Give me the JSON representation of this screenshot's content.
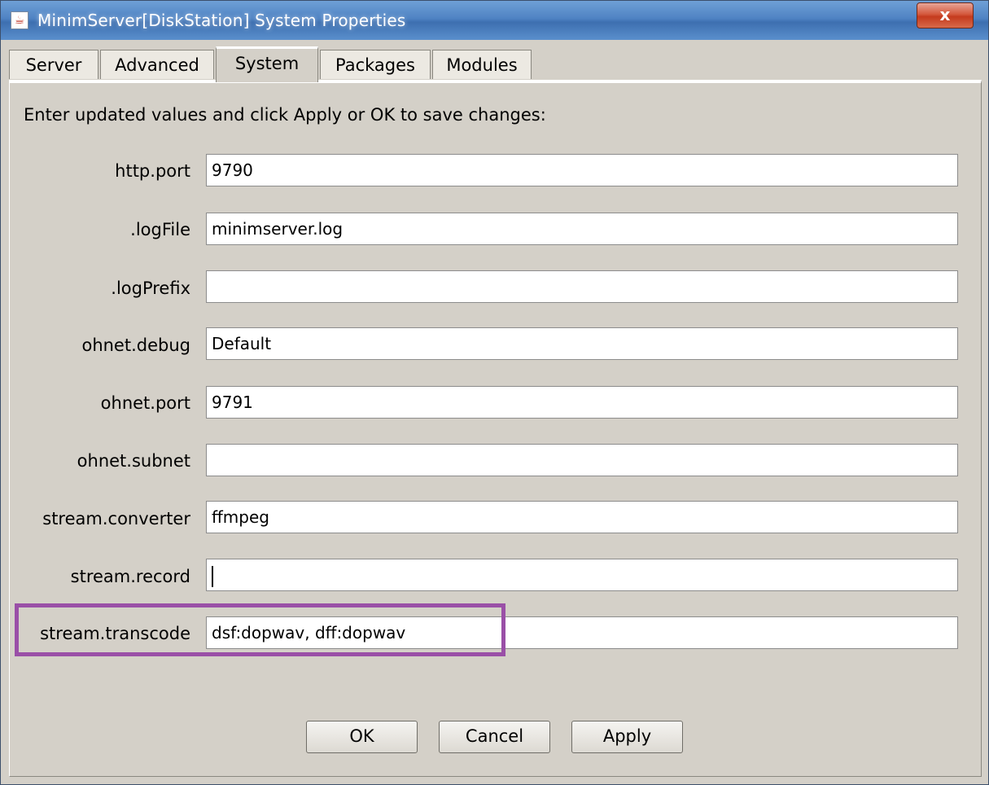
{
  "window": {
    "title": "MinimServer[DiskStation] System Properties",
    "close_label": "x"
  },
  "tabs": [
    {
      "label": "Server",
      "active": false
    },
    {
      "label": "Advanced",
      "active": false
    },
    {
      "label": "System",
      "active": true
    },
    {
      "label": "Packages",
      "active": false
    },
    {
      "label": "Modules",
      "active": false
    }
  ],
  "instructions": "Enter updated values and click Apply or OK to save changes:",
  "properties": [
    {
      "label": "http.port",
      "value": "9790"
    },
    {
      "label": ".logFile",
      "value": "minimserver.log"
    },
    {
      "label": ".logPrefix",
      "value": ""
    },
    {
      "label": "ohnet.debug",
      "value": "Default"
    },
    {
      "label": "ohnet.port",
      "value": "9791"
    },
    {
      "label": "ohnet.subnet",
      "value": ""
    },
    {
      "label": "stream.converter",
      "value": "ffmpeg"
    },
    {
      "label": "stream.record",
      "value": ""
    },
    {
      "label": "stream.transcode",
      "value": "dsf:dopwav, dff:dopwav"
    }
  ],
  "buttons": {
    "ok": "OK",
    "cancel": "Cancel",
    "apply": "Apply"
  },
  "colors": {
    "highlight": "#9a4fa7",
    "panel": "#d4d0c8"
  }
}
